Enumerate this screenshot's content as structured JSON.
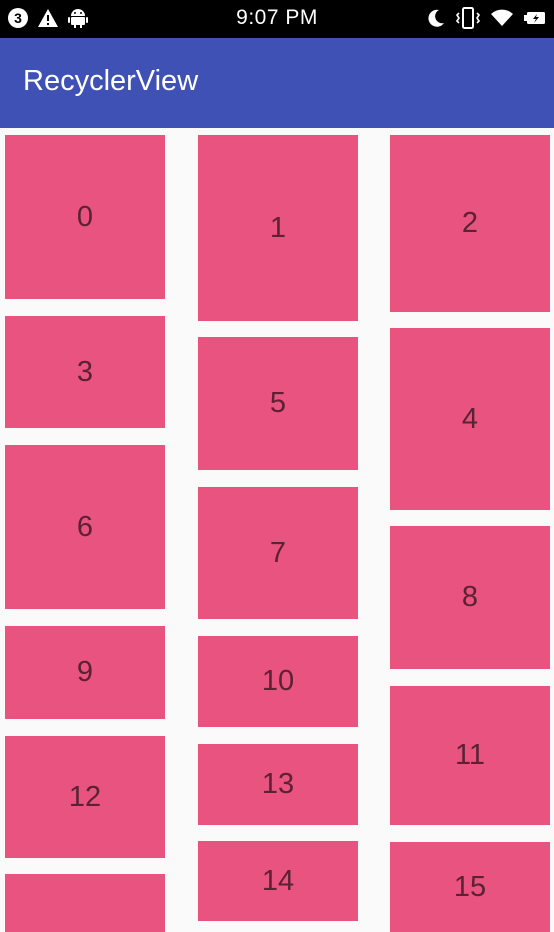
{
  "status_bar": {
    "notification_count": "3",
    "time": "9:07 PM",
    "icons": [
      "warning-icon",
      "android-icon",
      "moon-icon",
      "vibrate-icon",
      "wifi-icon",
      "battery-icon"
    ]
  },
  "app_bar": {
    "title": "RecyclerView"
  },
  "colors": {
    "app_bar": "#3f51b5",
    "card": "#e8537f",
    "card_text": "#5a2233",
    "background": "#fafafa"
  },
  "grid": {
    "columns": 3,
    "items": [
      {
        "label": "0"
      },
      {
        "label": "1"
      },
      {
        "label": "2"
      },
      {
        "label": "3"
      },
      {
        "label": "4"
      },
      {
        "label": "5"
      },
      {
        "label": "6"
      },
      {
        "label": "7"
      },
      {
        "label": "8"
      },
      {
        "label": "9"
      },
      {
        "label": "10"
      },
      {
        "label": "11"
      },
      {
        "label": "12"
      },
      {
        "label": "13"
      },
      {
        "label": "14"
      },
      {
        "label": "15"
      },
      {
        "label": ""
      }
    ]
  }
}
